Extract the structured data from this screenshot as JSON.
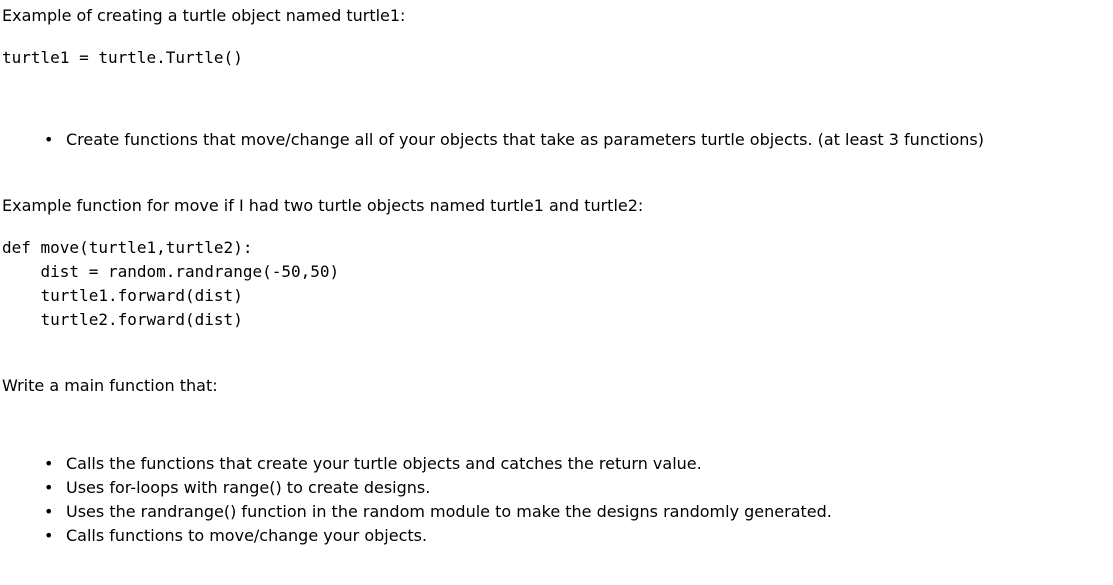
{
  "section1": {
    "intro": "Example of creating a turtle object named turtle1:",
    "code": "turtle1 = turtle.Turtle()"
  },
  "bullets1": {
    "items": [
      "Create functions that move/change all of your objects that take as parameters turtle objects. (at least 3 functions)"
    ]
  },
  "section2": {
    "intro": "Example function for move if I had two turtle objects named turtle1 and turtle2:",
    "code": "def move(turtle1,turtle2):\n    dist = random.randrange(-50,50)\n    turtle1.forward(dist)\n    turtle2.forward(dist)"
  },
  "section3": {
    "intro": "Write a main function that:"
  },
  "bullets2": {
    "items": [
      "Calls the functions that create your turtle objects and catches the return value.",
      "Uses for-loops with range() to create designs.",
      "Uses the randrange() function in the random module to make the designs randomly generated.",
      "Calls functions to move/change your objects."
    ]
  }
}
